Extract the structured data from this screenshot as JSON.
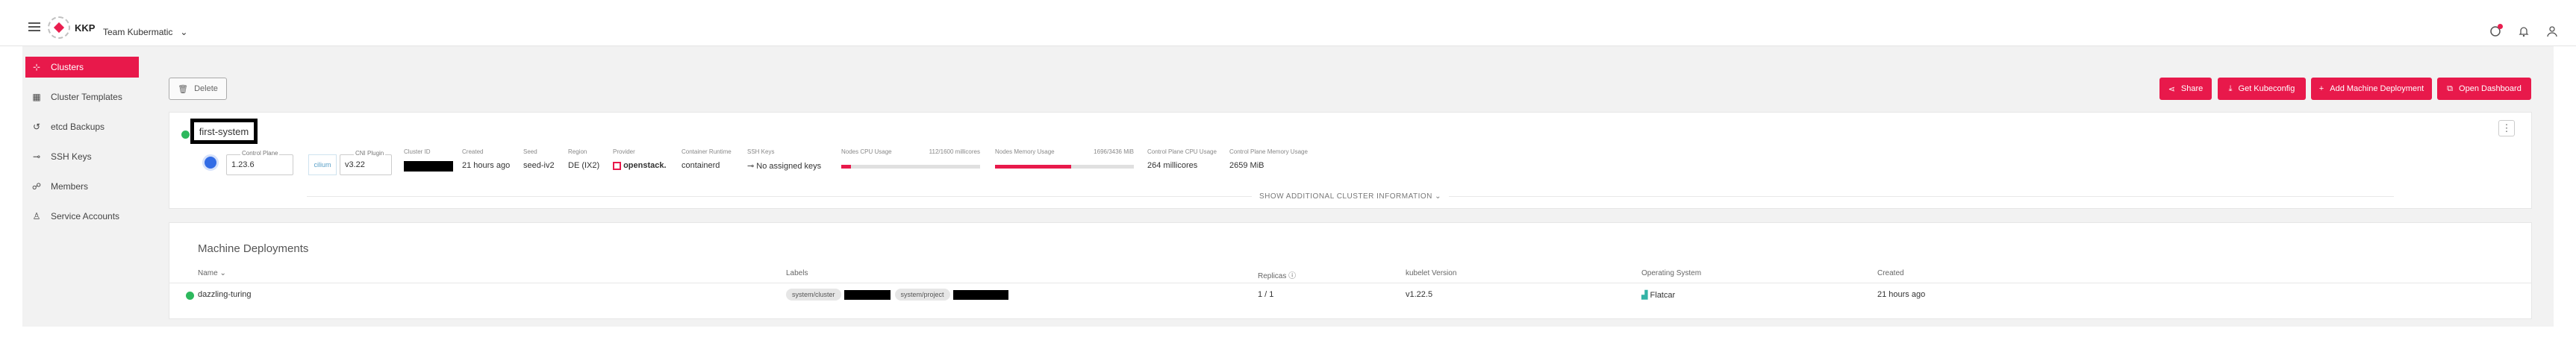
{
  "topbar": {
    "logo_text": "KKP",
    "project": "Team Kubermatic",
    "project_chevron": "⌄"
  },
  "sidebar": {
    "items": [
      {
        "label": "Clusters",
        "icon": "cluster-icon",
        "active": true
      },
      {
        "label": "Cluster Templates",
        "icon": "template-icon",
        "active": false
      },
      {
        "label": "etcd Backups",
        "icon": "backup-icon",
        "active": false
      },
      {
        "label": "SSH Keys",
        "icon": "key-icon",
        "active": false
      },
      {
        "label": "Members",
        "icon": "members-icon",
        "active": false
      },
      {
        "label": "Service Accounts",
        "icon": "service-accounts-icon",
        "active": false
      }
    ]
  },
  "toolbar": {
    "delete_label": "Delete",
    "share_label": "Share",
    "kubeconfig_label": "Get Kubeconfig",
    "add_md_label": "Add Machine Deployment",
    "dashboard_label": "Open Dashboard"
  },
  "cluster": {
    "name": "first-system",
    "control_plane_caption": "Control Plane",
    "control_plane_version": "1.23.6",
    "cni_caption": "CNI Plugin",
    "cni_logo": "cilium",
    "cni_version": "v3.22",
    "id_label": "Cluster ID",
    "created_label": "Created",
    "created_value": "21 hours ago",
    "seed_label": "Seed",
    "seed_value": "seed-iv2",
    "region_label": "Region",
    "region_value": "DE (IX2)",
    "provider_label": "Provider",
    "provider_value": "openstack.",
    "runtime_label": "Container Runtime",
    "runtime_value": "containerd",
    "ssh_label": "SSH Keys",
    "ssh_value": "No assigned keys",
    "cpu_label": "Nodes CPU Usage",
    "cpu_value": "112/1600 millicores",
    "cpu_fraction": 0.07,
    "mem_label": "Nodes Memory Usage",
    "mem_value": "1696/3436 MiB",
    "mem_fraction": 0.55,
    "cp_cpu_label": "Control Plane CPU Usage",
    "cp_cpu_value": "264 millicores",
    "cp_mem_label": "Control Plane Memory Usage",
    "cp_mem_value": "2659 MiB",
    "show_more": "SHOW ADDITIONAL CLUSTER INFORMATION ⌄"
  },
  "machine_deployments": {
    "title": "Machine Deployments",
    "columns": [
      "Name ⌄",
      "Labels",
      "Replicas ⓘ",
      "kubelet Version",
      "Operating System",
      "Created"
    ],
    "rows": [
      {
        "name": "dazzling-turing",
        "label1": "system/cluster",
        "label2": "system/project",
        "replicas": "1 / 1",
        "kubelet": "v1.22.5",
        "os": "Flatcar",
        "created": "21 hours ago"
      }
    ]
  },
  "colors": {
    "accent": "#e8194b",
    "healthy": "#2db85d"
  }
}
